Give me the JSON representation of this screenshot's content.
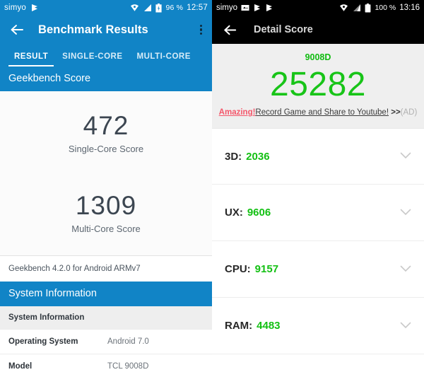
{
  "left": {
    "status_bar": {
      "carrier": "simyo",
      "carrier_icon": "flag-icon",
      "wifi_icon": "wifi-icon",
      "signal_icon": "signal-bars-icon",
      "battery_icon": "battery-charging-icon",
      "battery_percent": "96 %",
      "clock": "12:57"
    },
    "toolbar": {
      "back_icon": "back-arrow-icon",
      "title": "Benchmark Results",
      "overflow_icon": "overflow-menu-icon"
    },
    "tabs": [
      {
        "label": "RESULT",
        "active": true
      },
      {
        "label": "SINGLE-CORE",
        "active": false
      },
      {
        "label": "MULTI-CORE",
        "active": false
      }
    ],
    "score_section_title": "Geekbench Score",
    "scores": [
      {
        "value": "472",
        "label": "Single-Core Score"
      },
      {
        "value": "1309",
        "label": "Multi-Core Score"
      }
    ],
    "version_line": "Geekbench 4.2.0 for Android ARMv7",
    "system_section_title": "System Information",
    "table": {
      "head": "System Information",
      "rows": [
        {
          "key": "Operating System",
          "value": "Android 7.0"
        },
        {
          "key": "Model",
          "value": "TCL 9008D"
        }
      ]
    },
    "colors": {
      "accent": "#1184c6",
      "score_text": "#3c4651"
    }
  },
  "right": {
    "status_bar": {
      "carrier": "simyo",
      "sd_icon": "sd-card-icon",
      "flag_icon_1": "flag-icon",
      "flag_icon_2": "flag-icon",
      "wifi_icon": "wifi-icon",
      "signal_icon": "signal-bars-icon",
      "battery_icon": "battery-full-icon",
      "battery_percent": "100 %",
      "clock": "13:16"
    },
    "toolbar": {
      "back_icon": "back-arrow-icon",
      "title": "Detail Score"
    },
    "header": {
      "device_model": "9008D",
      "total_score": "25282",
      "ad": {
        "highlight": "Amazing!",
        "text": "Record Game and Share to Youtube!",
        "arrows": ">>",
        "tag": "(AD)"
      }
    },
    "items": [
      {
        "key": "3D:",
        "value": "2036",
        "chevron_icon": "chevron-down-icon"
      },
      {
        "key": "UX:",
        "value": "9606",
        "chevron_icon": "chevron-down-icon"
      },
      {
        "key": "CPU:",
        "value": "9157",
        "chevron_icon": "chevron-down-icon"
      },
      {
        "key": "RAM:",
        "value": "4483",
        "chevron_icon": "chevron-down-icon"
      }
    ],
    "colors": {
      "accent": "#18c418",
      "toolbar_bg": "#000000",
      "header_bg": "#efefef"
    }
  }
}
